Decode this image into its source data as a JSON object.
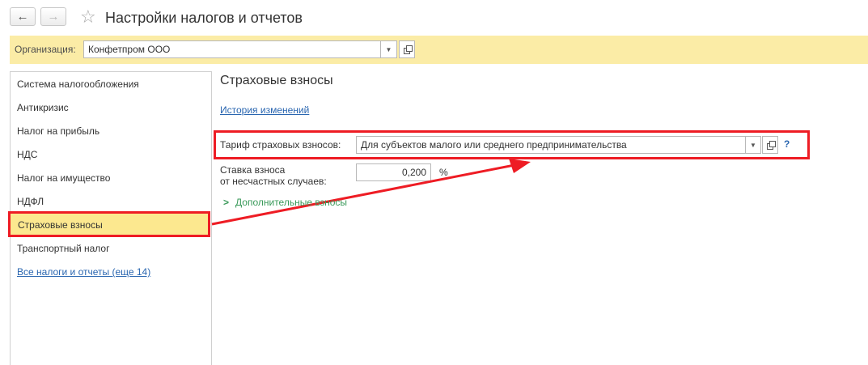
{
  "header": {
    "title": "Настройки налогов и отчетов",
    "back_icon": "←",
    "forward_icon": "→",
    "star_icon": "☆"
  },
  "org_bar": {
    "label": "Организация:",
    "value": "Конфетпром ООО"
  },
  "sidebar": {
    "items": [
      "Система налогообложения",
      "Антикризис",
      "Налог на прибыль",
      "НДС",
      "Налог на имущество",
      "НДФЛ",
      "Страховые взносы",
      "Транспортный налог"
    ],
    "all_link": "Все налоги и отчеты (еще 14)"
  },
  "main": {
    "section_title": "Страховые взносы",
    "history_link": "История изменений",
    "tariff_label": "Тариф страховых взносов:",
    "tariff_value": "Для субъектов малого или среднего предпринимательства",
    "help": "?",
    "rate_label_line1": "Ставка взноса",
    "rate_label_line2": "от несчастных случаев:",
    "rate_value": "0,200",
    "rate_unit": "%",
    "extra_label": "Дополнительные взносы"
  },
  "colors": {
    "accent_yellow": "#fbeca6",
    "selected_yellow": "#fce88f",
    "highlight_red": "#ee1c24",
    "link_blue": "#2a66b0",
    "green": "#3a9a5a"
  }
}
